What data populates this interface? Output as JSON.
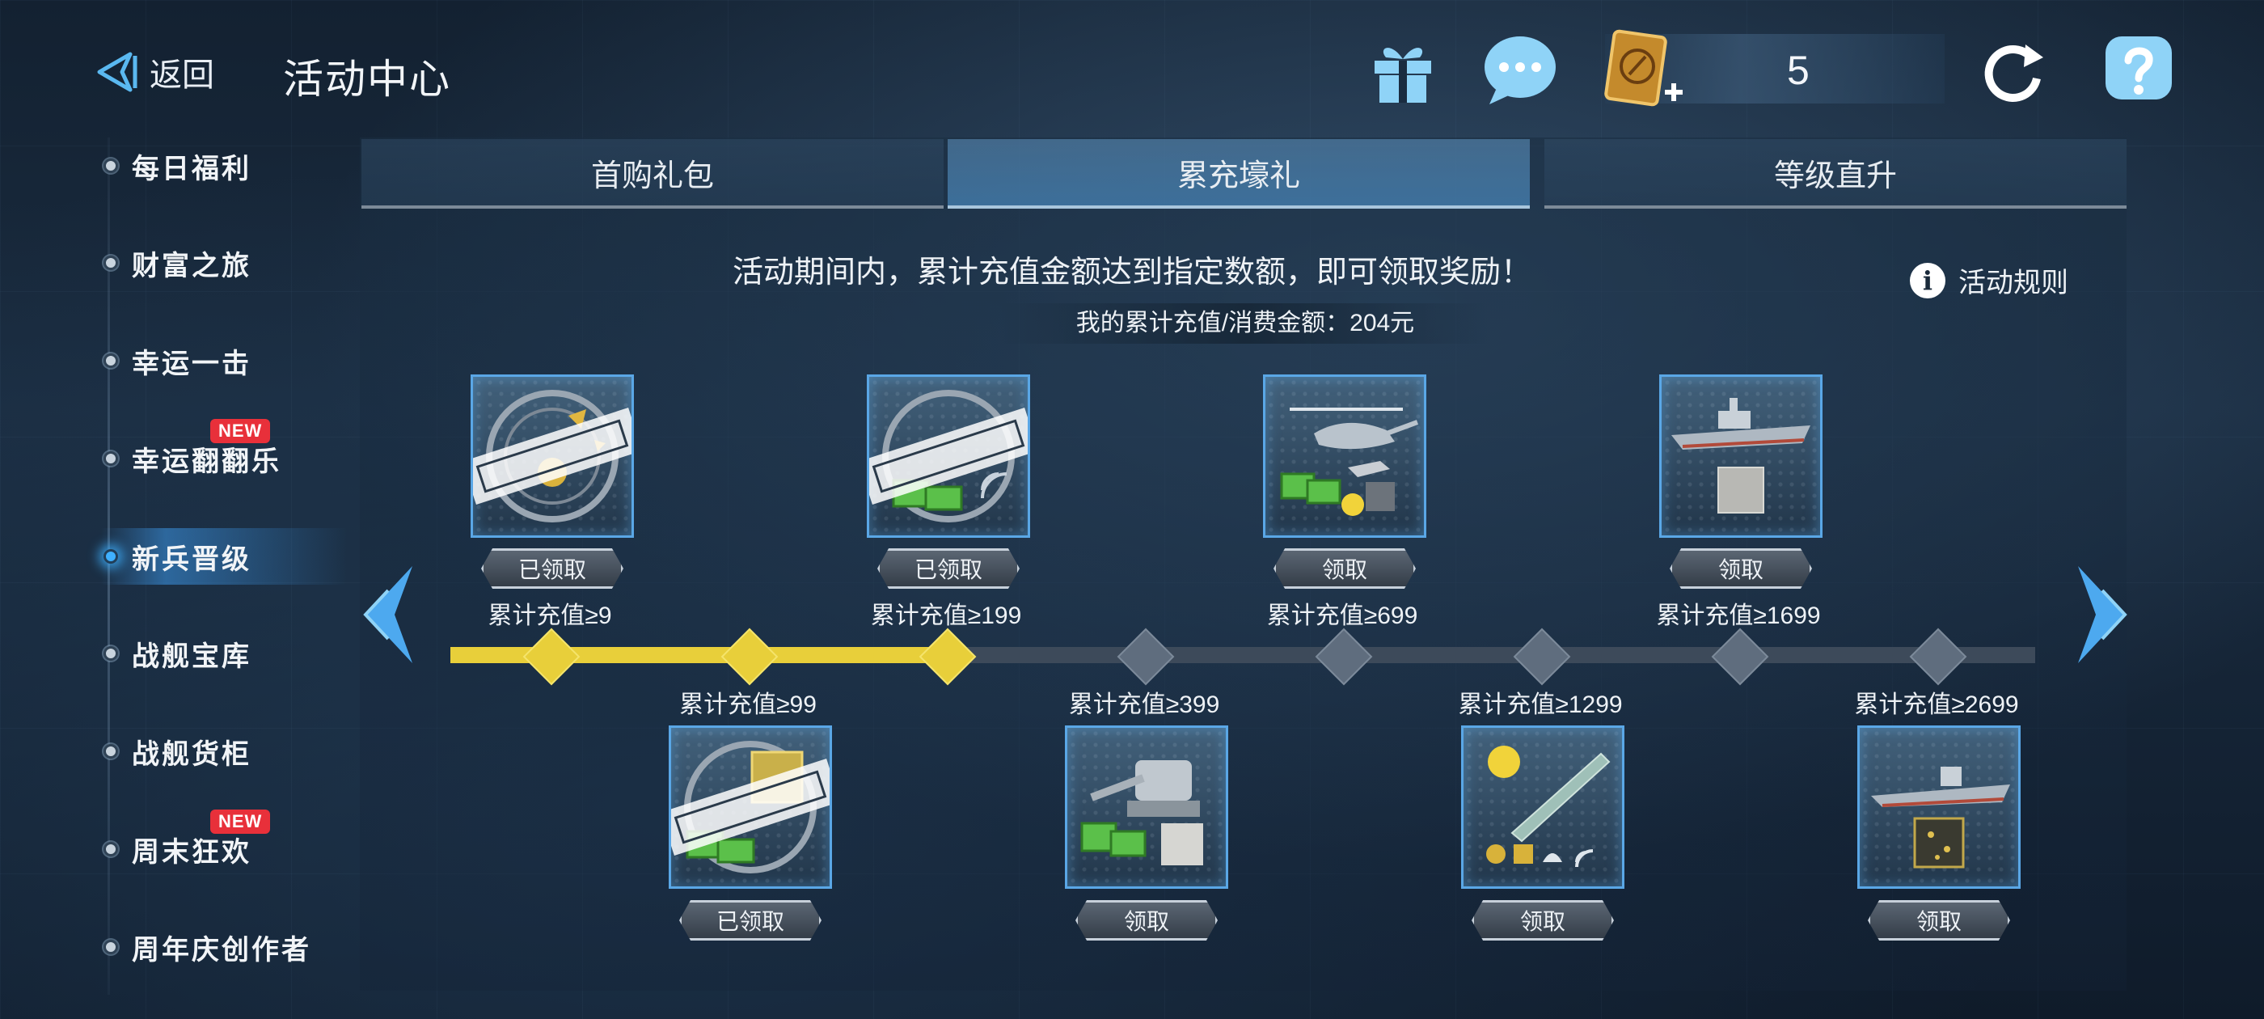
{
  "header": {
    "back_label": "返回",
    "title": "活动中心",
    "currency_value": "5"
  },
  "top_icons": [
    "gift-icon",
    "chat-icon",
    "refresh-icon",
    "help-icon"
  ],
  "sidebar": {
    "items": [
      {
        "label": "每日福利"
      },
      {
        "label": "财富之旅"
      },
      {
        "label": "幸运一击"
      },
      {
        "label": "幸运翻翻乐",
        "badge": "NEW"
      },
      {
        "label": "新兵晋级",
        "active": true
      },
      {
        "label": "战舰宝库"
      },
      {
        "label": "战舰货柜"
      },
      {
        "label": "周末狂欢",
        "badge": "NEW"
      },
      {
        "label": "周年庆创作者"
      }
    ]
  },
  "tabs": [
    {
      "label": "首购礼包"
    },
    {
      "label": "累充壕礼",
      "active": true
    },
    {
      "label": "等级直升"
    }
  ],
  "content": {
    "description": "活动期间内，累计充值金额达到指定数额，即可领取奖励！",
    "total_recharge": "我的累计充值/消费金额：204元",
    "rules_label": "活动规则"
  },
  "progress": {
    "reached_nodes": 3,
    "total_nodes": 8
  },
  "tiers": [
    {
      "label": "累计充值≥9",
      "button": "已领取",
      "claimed": true,
      "reward": "medal-and-stamp"
    },
    {
      "label": "累计充值≥99",
      "button": "已领取",
      "claimed": true,
      "reward": "gold-box-and-stamp"
    },
    {
      "label": "累计充值≥199",
      "button": "已领取",
      "claimed": true,
      "reward": "green-crates-and-stamp"
    },
    {
      "label": "累计充值≥399",
      "button": "领取",
      "claimed": false,
      "reward": "turret-and-crates"
    },
    {
      "label": "累计充值≥699",
      "button": "领取",
      "claimed": false,
      "reward": "helicopter-and-crates"
    },
    {
      "label": "累计充值≥1299",
      "button": "领取",
      "claimed": false,
      "reward": "missile-and-items"
    },
    {
      "label": "累计充值≥1699",
      "button": "领取",
      "claimed": false,
      "reward": "battleship-and-plate"
    },
    {
      "label": "累计充值≥2699",
      "button": "领取",
      "claimed": false,
      "reward": "carrier-and-box"
    }
  ]
}
